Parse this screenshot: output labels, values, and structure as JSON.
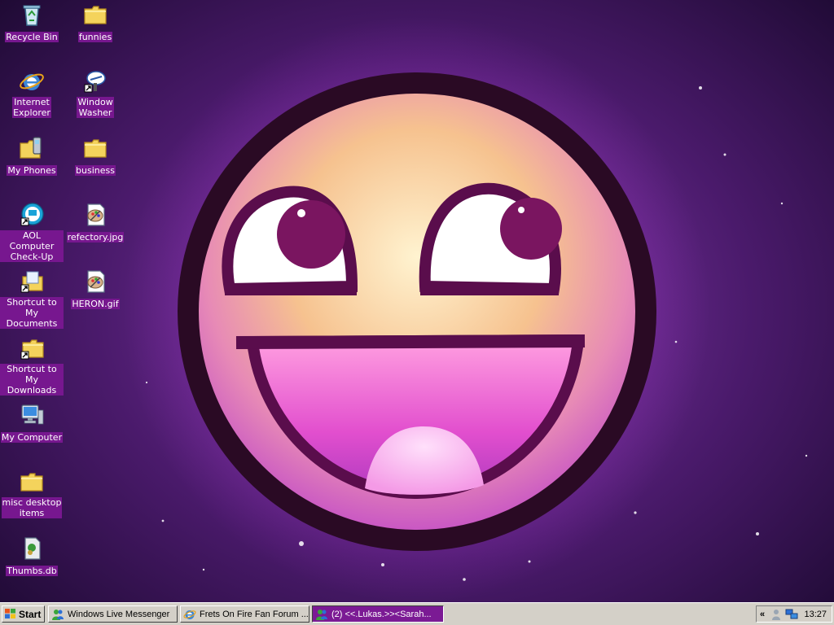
{
  "desktop": {
    "icons": [
      {
        "label": "Recycle Bin",
        "icon": "recycle-bin-icon"
      },
      {
        "label": "funnies",
        "icon": "folder-icon"
      },
      {
        "label": "Internet\nExplorer",
        "icon": "internet-explorer-icon"
      },
      {
        "label": "Window\nWasher",
        "icon": "window-washer-icon"
      },
      {
        "label": "My Phones",
        "icon": "phones-folder-icon"
      },
      {
        "label": "business",
        "icon": "folder-icon"
      },
      {
        "label": "AOL Computer\nCheck-Up",
        "icon": "aol-checkup-icon"
      },
      {
        "label": "refectory.jpg",
        "icon": "image-file-icon"
      },
      {
        "label": "Shortcut to My\nDocuments",
        "icon": "documents-shortcut-icon"
      },
      {
        "label": "HERON.gif",
        "icon": "image-file-icon"
      },
      {
        "label": "Shortcut to My\nDownloads",
        "icon": "folder-shortcut-icon"
      },
      {
        "label": "My Computer",
        "icon": "my-computer-icon"
      },
      {
        "label": "misc desktop\nitems",
        "icon": "folder-icon"
      },
      {
        "label": "Thumbs.db",
        "icon": "thumbs-db-icon"
      }
    ],
    "wallpaper": "smiley-face-wallpaper"
  },
  "taskbar": {
    "start_label": "Start",
    "tasks": [
      {
        "label": "Windows Live Messenger",
        "icon": "messenger-icon",
        "active": false
      },
      {
        "label": "Frets On Fire Fan Forum ...",
        "icon": "internet-explorer-icon",
        "active": false
      },
      {
        "label": "(2) <<.Lukas.>><Sarah...",
        "icon": "messenger-icon",
        "active": true
      }
    ],
    "tray": {
      "expand_label": "«",
      "clock": "13:27",
      "icons": [
        "messenger-tray-icon",
        "network-tray-icon"
      ]
    }
  },
  "colors": {
    "label_highlight": "#77178f",
    "taskbar": "#d4d0c8",
    "active_task": "#7b1a94"
  }
}
